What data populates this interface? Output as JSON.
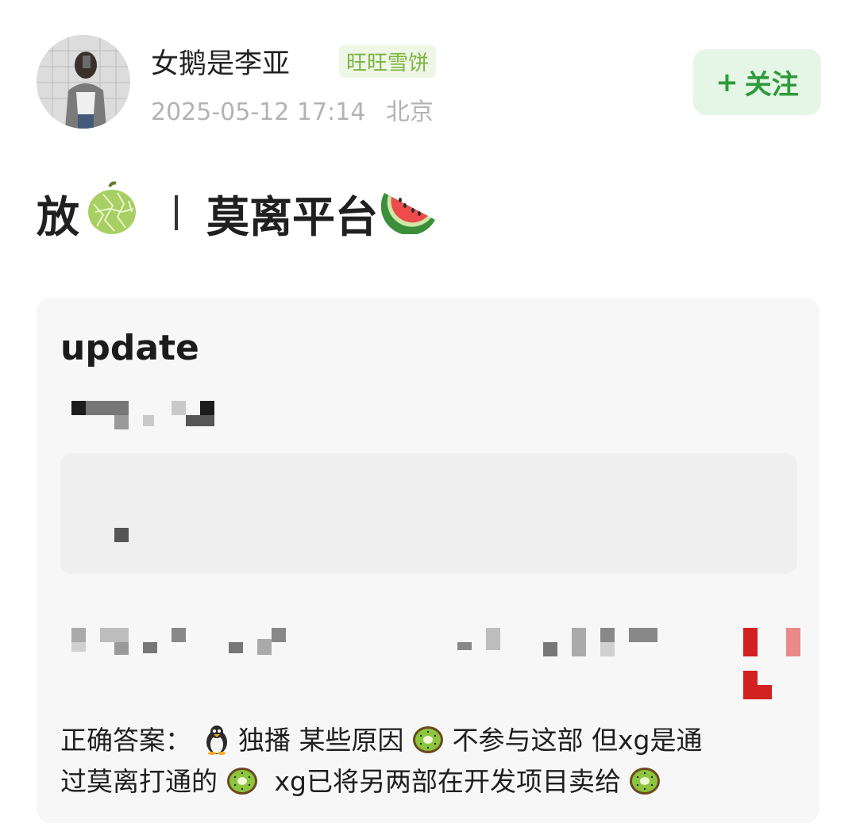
{
  "author": {
    "name": "女鹅是李亚",
    "badge": "旺旺雪饼",
    "date": "2025-05-12 17:14",
    "location": "北京",
    "avatar_icon": "avatar-photo"
  },
  "follow_button": {
    "plus": "+",
    "label": "关注"
  },
  "post": {
    "title_prefix": "放",
    "title_main": "莫离平台",
    "title_icons": [
      "melon-icon",
      "watermelon-icon"
    ]
  },
  "card": {
    "heading": "update",
    "answer_label": "正确答案：",
    "answer_part1": "独播 某些原因",
    "answer_part2": "不参与这部 但xg是通",
    "answer_part3": "过莫离打通的",
    "answer_part4": " xg已将另两部在开发项目卖给",
    "inline_icons": [
      "penguin-icon",
      "kiwi-icon"
    ]
  },
  "colors": {
    "follow_bg": "#e6f6e6",
    "follow_text": "#2e9a3c",
    "badge_bg": "#eef7e6",
    "badge_text": "#7cb342",
    "card_bg": "#f7f7f7"
  }
}
